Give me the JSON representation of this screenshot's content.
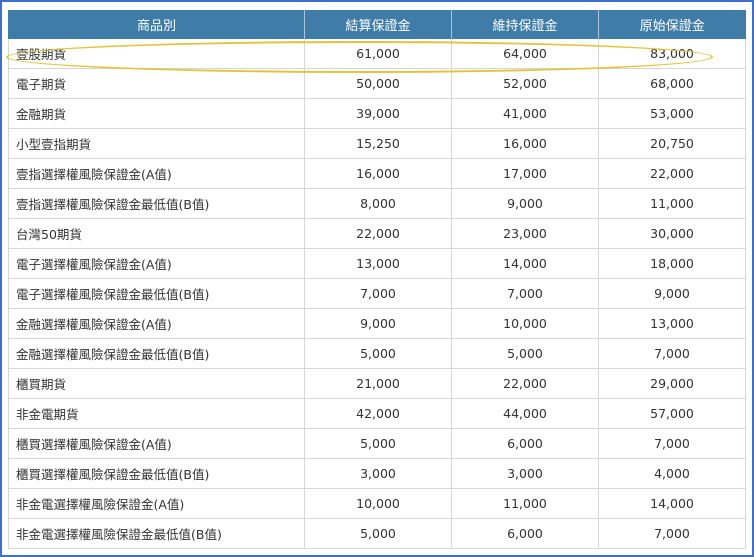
{
  "table": {
    "headers": [
      "商品別",
      "結算保證金",
      "維持保證金",
      "原始保證金"
    ],
    "rows": [
      [
        "壹股期貨",
        "61,000",
        "64,000",
        "83,000"
      ],
      [
        "電子期貨",
        "50,000",
        "52,000",
        "68,000"
      ],
      [
        "金融期貨",
        "39,000",
        "41,000",
        "53,000"
      ],
      [
        "小型壹指期貨",
        "15,250",
        "16,000",
        "20,750"
      ],
      [
        "壹指選擇權風險保證金(A值)",
        "16,000",
        "17,000",
        "22,000"
      ],
      [
        "壹指選擇權風險保證金最低值(B值)",
        "8,000",
        "9,000",
        "11,000"
      ],
      [
        "台灣50期貨",
        "22,000",
        "23,000",
        "30,000"
      ],
      [
        "電子選擇權風險保證金(A值)",
        "13,000",
        "14,000",
        "18,000"
      ],
      [
        "電子選擇權風險保證金最低值(B值)",
        "7,000",
        "7,000",
        "9,000"
      ],
      [
        "金融選擇權風險保證金(A值)",
        "9,000",
        "10,000",
        "13,000"
      ],
      [
        "金融選擇權風險保證金最低值(B值)",
        "5,000",
        "5,000",
        "7,000"
      ],
      [
        "櫃買期貨",
        "21,000",
        "22,000",
        "29,000"
      ],
      [
        "非金電期貨",
        "42,000",
        "44,000",
        "57,000"
      ],
      [
        "櫃買選擇權風險保證金(A值)",
        "5,000",
        "6,000",
        "7,000"
      ],
      [
        "櫃買選擇權風險保證金最低值(B值)",
        "3,000",
        "3,000",
        "4,000"
      ],
      [
        "非金電選擇權風險保證金(A值)",
        "10,000",
        "11,000",
        "14,000"
      ],
      [
        "非金電選擇權風險保證金最低值(B值)",
        "5,000",
        "6,000",
        "7,000"
      ]
    ]
  },
  "colors": {
    "header_bg": "#3f7ca8",
    "frame_border": "#3d6fd1",
    "highlight": "#e2c43c"
  }
}
